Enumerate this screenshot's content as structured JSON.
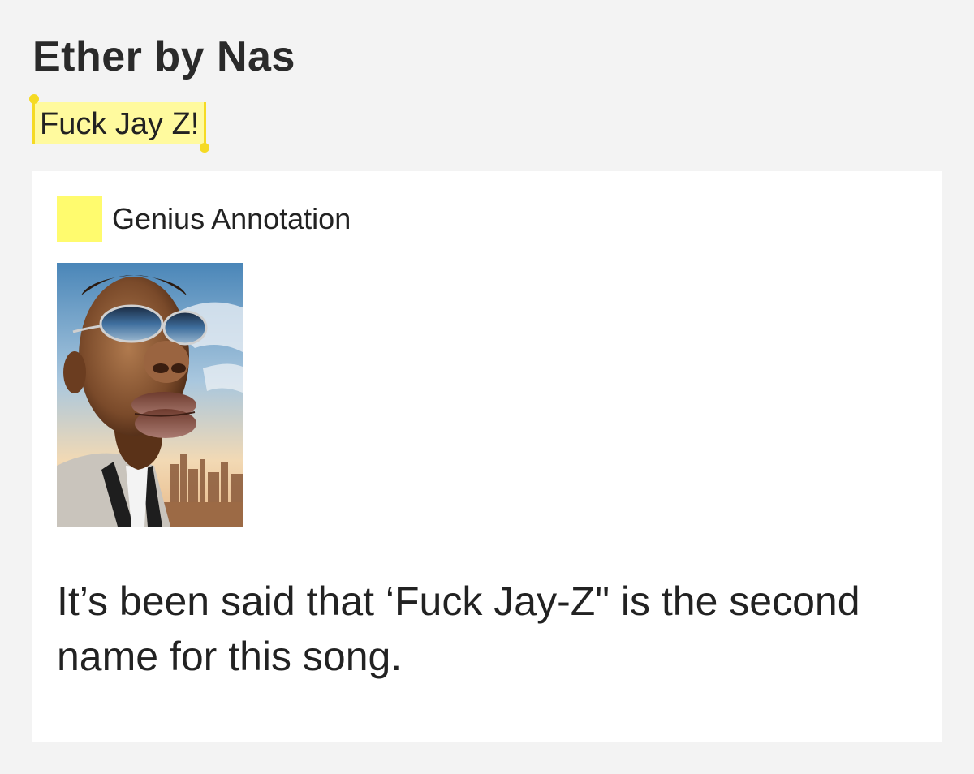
{
  "song": {
    "title": "Ether by Nas"
  },
  "lyric": {
    "highlighted_text": "Fuck Jay Z!"
  },
  "annotation": {
    "label": "Genius Annotation",
    "swatch_icon": "yellow-square-icon",
    "image_icon": "caricature-portrait-image",
    "body": "It’s been said that ‘Fuck Jay-Z\" is the second name for this song."
  },
  "colors": {
    "page_background": "#f3f3f3",
    "highlight": "#fffa9e",
    "highlight_handle": "#f5da23",
    "annotation_swatch": "#fffb6e",
    "card_background": "#ffffff"
  }
}
